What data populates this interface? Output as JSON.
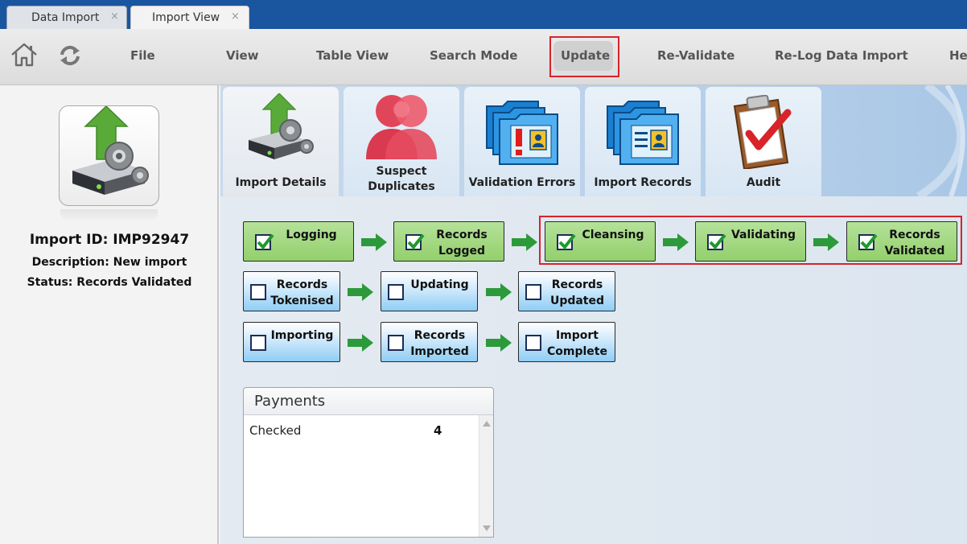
{
  "doc_tabs": [
    {
      "label": "Data Import",
      "close": "×"
    },
    {
      "label": "Import View",
      "close": "×"
    }
  ],
  "toolbar": {
    "items": [
      "File",
      "View",
      "Table View",
      "Search Mode",
      "Update",
      "Re-Validate",
      "Re-Log Data Import",
      "Help"
    ],
    "icons": [
      "home-icon",
      "refresh-icon"
    ]
  },
  "left": {
    "import_id": "Import ID: IMP92947",
    "description": "Description: New import",
    "status": "Status: Records Validated"
  },
  "view_tabs": [
    {
      "label": "Import Details",
      "icon": "server-upload-icon"
    },
    {
      "label": "Suspect Duplicates",
      "icon": "people-icon"
    },
    {
      "label": "Validation Errors",
      "icon": "folder-alert-icon"
    },
    {
      "label": "Import Records",
      "icon": "folder-records-icon"
    },
    {
      "label": "Audit",
      "icon": "clipboard-check-icon"
    }
  ],
  "workflow": {
    "row1": [
      {
        "label": "Logging",
        "done": true
      },
      {
        "label": "Records Logged",
        "done": true
      },
      {
        "label": "Cleansing",
        "done": true
      },
      {
        "label": "Validating",
        "done": true
      },
      {
        "label": "Records Validated",
        "done": true
      }
    ],
    "row2": [
      {
        "label": "Records Tokenised",
        "done": false
      },
      {
        "label": "Updating",
        "done": false
      },
      {
        "label": "Records Updated",
        "done": false
      }
    ],
    "row3": [
      {
        "label": "Importing",
        "done": false
      },
      {
        "label": "Records Imported",
        "done": false
      },
      {
        "label": "Import Complete",
        "done": false
      }
    ]
  },
  "payments": {
    "title": "Payments",
    "rows": [
      {
        "label": "Checked",
        "value": "4"
      }
    ]
  },
  "colors": {
    "accent_blue": "#1a55a0",
    "highlight_red": "#d8232a",
    "step_green": "#93cf6c",
    "step_blue": "#8fcdf5"
  }
}
